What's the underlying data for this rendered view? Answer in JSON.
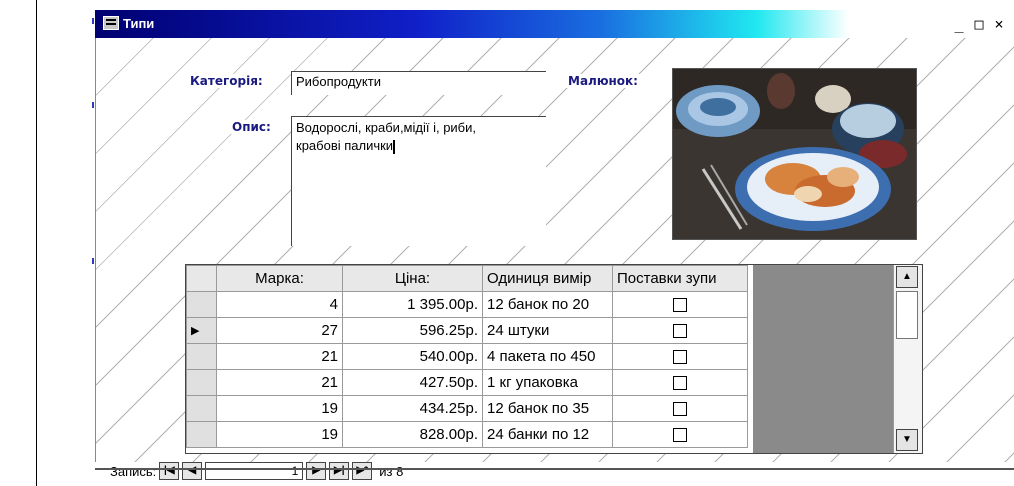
{
  "window": {
    "title": "Типи",
    "minimize_label": "_",
    "maximize_label": "□",
    "close_label": "×"
  },
  "form": {
    "category_label": "Категорія:",
    "category_value": "Рибопродукти",
    "picture_label": "Малюнок:",
    "description_label": "Опис:",
    "description_value": "Водорослі, краби,мідії і, риби,\nкрабові палички"
  },
  "grid": {
    "headers": [
      "Марка:",
      "Ціна:",
      "Одиниця вимір",
      "Поставки зупи"
    ],
    "rows": [
      {
        "brand": "4",
        "price": "1 395.00р.",
        "unit": "12 банок по 20",
        "current": false
      },
      {
        "brand": "27",
        "price": "596.25р.",
        "unit": "24 штуки",
        "current": true
      },
      {
        "brand": "21",
        "price": "540.00р.",
        "unit": "4 пакета по 450",
        "current": false
      },
      {
        "brand": "21",
        "price": "427.50р.",
        "unit": "1 кг упаковка",
        "current": false
      },
      {
        "brand": "19",
        "price": "434.25р.",
        "unit": "12 банок по 35",
        "current": false
      },
      {
        "brand": "19",
        "price": "828.00р.",
        "unit": "24 банки по 12",
        "current": false
      }
    ]
  },
  "nav": {
    "record_label": "Запись:",
    "current_record": "1",
    "of_text": "из 8"
  },
  "icons": [
    "app-icon",
    "row-pointer-icon",
    "scroll-up-icon",
    "scroll-down-icon",
    "first-record-icon",
    "prev-record-icon",
    "next-record-icon",
    "last-record-icon",
    "new-record-icon"
  ]
}
